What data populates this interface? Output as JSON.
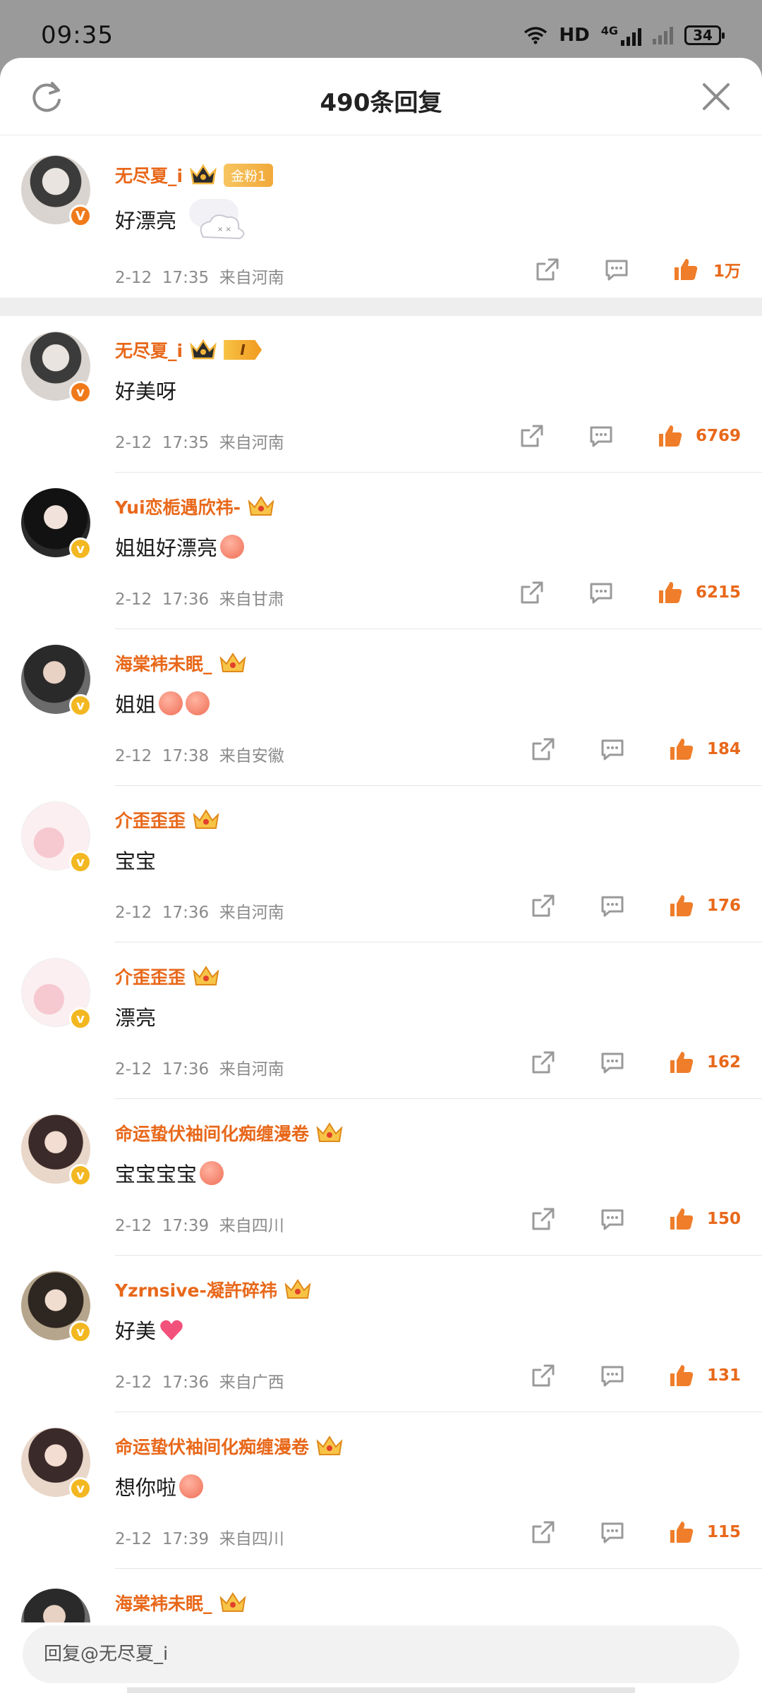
{
  "status": {
    "time": "09:35",
    "net": "HD",
    "net2": "4G",
    "battery": "34"
  },
  "header": {
    "title": "490条回复"
  },
  "root": {
    "user": "无尽夏_i",
    "fan_badge": "金粉1",
    "text": "好漂亮",
    "date": "2-12",
    "time": "17:35",
    "location": "来自河南",
    "likes": "1万"
  },
  "replies": [
    {
      "user": "无尽夏_i",
      "badge": "I",
      "text": "好美呀",
      "date": "2-12",
      "time": "17:35",
      "location": "来自河南",
      "likes": "6769"
    },
    {
      "user": "Yui恋栀遇欣祎-",
      "text": "姐姐好漂亮",
      "date": "2-12",
      "time": "17:36",
      "location": "来自甘肃",
      "likes": "6215"
    },
    {
      "user": "海棠袆未眠_",
      "text": "姐姐",
      "date": "2-12",
      "time": "17:38",
      "location": "来自安徽",
      "likes": "184"
    },
    {
      "user": "介歪歪歪",
      "text": "宝宝",
      "date": "2-12",
      "time": "17:36",
      "location": "来自河南",
      "likes": "176"
    },
    {
      "user": "介歪歪歪",
      "text": "漂亮",
      "date": "2-12",
      "time": "17:36",
      "location": "来自河南",
      "likes": "162"
    },
    {
      "user": "命运蛰伏袖间化痴缠漫卷",
      "text": "宝宝宝宝",
      "date": "2-12",
      "time": "17:39",
      "location": "来自四川",
      "likes": "150"
    },
    {
      "user": "Yzrnsive-凝許碎祎",
      "text": "好美",
      "date": "2-12",
      "time": "17:36",
      "location": "来自广西",
      "likes": "131"
    },
    {
      "user": "命运蛰伏袖间化痴缠漫卷",
      "text": "想你啦",
      "date": "2-12",
      "time": "17:39",
      "location": "来自四川",
      "likes": "115"
    },
    {
      "user": "海棠袆未眠_"
    }
  ],
  "input": {
    "placeholder": "回复@无尽夏_i"
  },
  "colors": {
    "accent": "#e8681a",
    "meta": "#8a8a8a",
    "badge_gold": "#f3b821",
    "badge_orange": "#f07a1a"
  },
  "icons": [
    "refresh-icon",
    "close-icon",
    "share-icon",
    "comment-icon",
    "thumb-up-icon",
    "crown-icon",
    "verified-icon"
  ]
}
